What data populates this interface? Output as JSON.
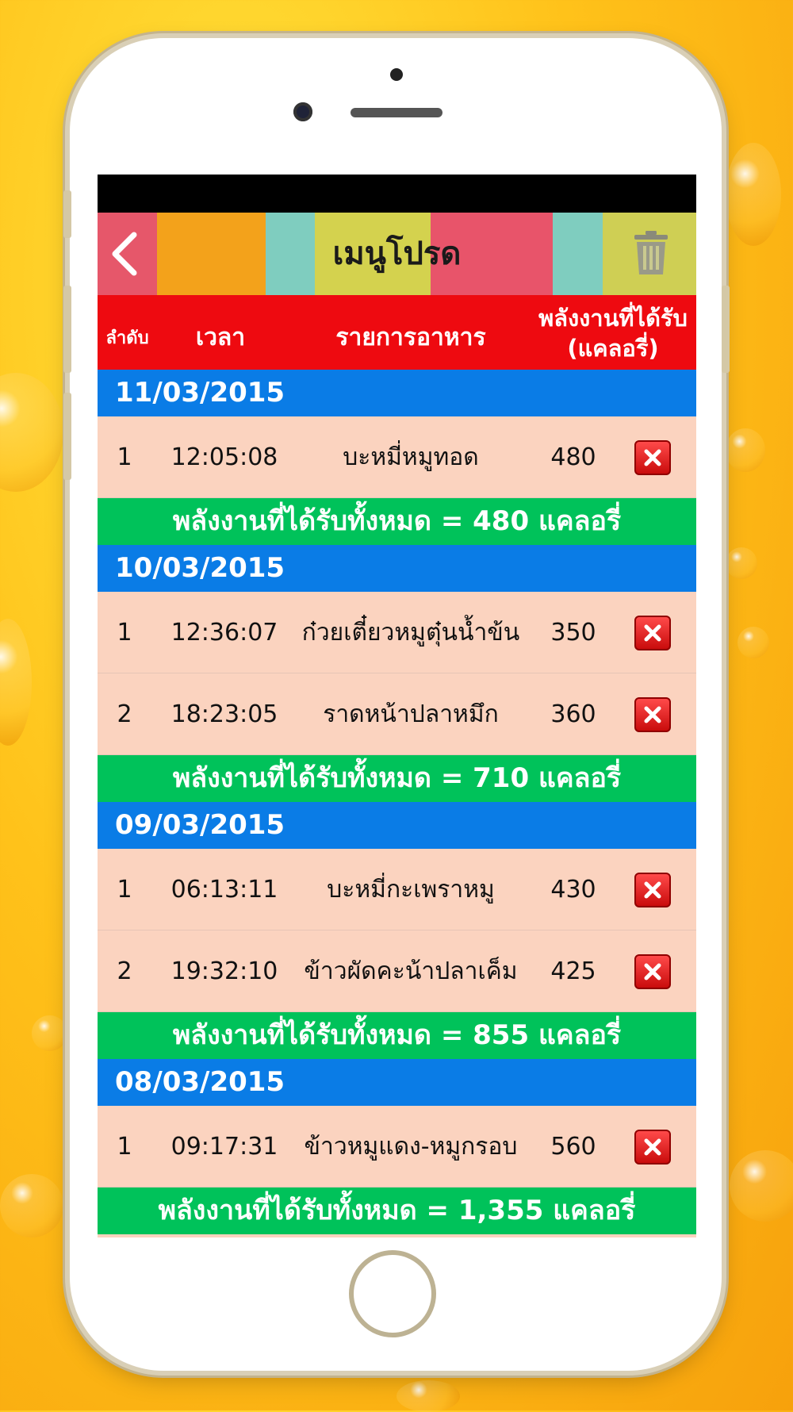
{
  "app": {
    "title": "เมนูโปรด",
    "nav_stripes": [
      "#e6576a",
      "#f3a21b",
      "#7fcdbf",
      "#d4d24e",
      "#e8546a",
      "#7fcdbf",
      "#cfcf54"
    ]
  },
  "table_header": {
    "order": "ลำดับ",
    "time": "เวลา",
    "food": "รายการอาหาร",
    "energy": "พลังงานที่ได้รับ (แคลอรี่)"
  },
  "days": [
    {
      "date": "11/03/2015",
      "items": [
        {
          "index": "1",
          "time": "12:05:08",
          "food": "บะหมี่หมูทอด",
          "kcal": "480"
        }
      ],
      "total": "พลังงานที่ได้รับทั้งหมด = 480 แคลอรี่"
    },
    {
      "date": "10/03/2015",
      "items": [
        {
          "index": "1",
          "time": "12:36:07",
          "food": "ก๋วยเตี๋ยวหมูตุ๋นน้ำข้น",
          "kcal": "350"
        },
        {
          "index": "2",
          "time": "18:23:05",
          "food": "ราดหน้าปลาหมึก",
          "kcal": "360"
        }
      ],
      "total": "พลังงานที่ได้รับทั้งหมด = 710 แคลอรี่"
    },
    {
      "date": "09/03/2015",
      "items": [
        {
          "index": "1",
          "time": "06:13:11",
          "food": "บะหมี่กะเพราหมู",
          "kcal": "430"
        },
        {
          "index": "2",
          "time": "19:32:10",
          "food": "ข้าวผัดคะน้าปลาเค็ม",
          "kcal": "425"
        }
      ],
      "total": "พลังงานที่ได้รับทั้งหมด = 855 แคลอรี่"
    },
    {
      "date": "08/03/2015",
      "items": [
        {
          "index": "1",
          "time": "09:17:31",
          "food": "ข้าวหมูแดง-หมูกรอบ",
          "kcal": "560"
        }
      ],
      "total": "พลังงานที่ได้รับทั้งหมด = 1,355 แคลอรี่"
    }
  ],
  "colors": {
    "header": "#ee0a10",
    "date_row": "#0a7ce6",
    "total_row": "#00c25a",
    "item_row": "#fbd3bf"
  },
  "icons": {
    "back": "chevron-left-icon",
    "trash": "trash-icon",
    "delete": "close-icon"
  }
}
